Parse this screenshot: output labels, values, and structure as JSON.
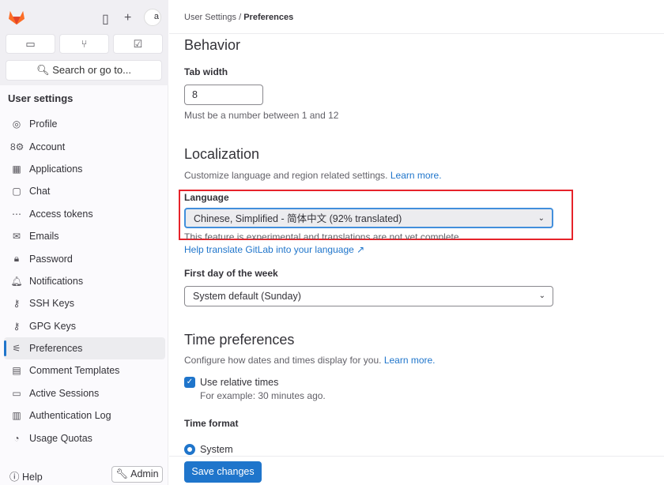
{
  "topbar": {
    "avatar_text": "a",
    "search_label": "Search or go to..."
  },
  "sidebar": {
    "title": "User settings",
    "items": [
      {
        "label": "Profile",
        "icon": "profile-icon",
        "glyph": "◎"
      },
      {
        "label": "Account",
        "icon": "account-icon",
        "glyph": "8⚙"
      },
      {
        "label": "Applications",
        "icon": "applications-icon",
        "glyph": "▦"
      },
      {
        "label": "Chat",
        "icon": "chat-icon",
        "glyph": "▢"
      },
      {
        "label": "Access tokens",
        "icon": "token-icon",
        "glyph": "⋯"
      },
      {
        "label": "Emails",
        "icon": "email-icon",
        "glyph": "✉"
      },
      {
        "label": "Password",
        "icon": "lock-icon",
        "glyph": "🔒︎"
      },
      {
        "label": "Notifications",
        "icon": "bell-icon",
        "glyph": "🔔︎"
      },
      {
        "label": "SSH Keys",
        "icon": "key-icon",
        "glyph": "⚷"
      },
      {
        "label": "GPG Keys",
        "icon": "key-icon",
        "glyph": "⚷"
      },
      {
        "label": "Preferences",
        "icon": "preferences-icon",
        "glyph": "⚟",
        "active": true
      },
      {
        "label": "Comment Templates",
        "icon": "comment-icon",
        "glyph": "▤"
      },
      {
        "label": "Active Sessions",
        "icon": "monitor-icon",
        "glyph": "▭"
      },
      {
        "label": "Authentication Log",
        "icon": "log-icon",
        "glyph": "▥"
      },
      {
        "label": "Usage Quotas",
        "icon": "quota-icon",
        "glyph": "◔"
      }
    ],
    "help": "Help",
    "admin": "Admin"
  },
  "breadcrumb": {
    "parent": "User Settings",
    "sep": "/",
    "current": "Preferences"
  },
  "behavior": {
    "title": "Behavior",
    "tab_width_label": "Tab width",
    "tab_width_value": "8",
    "tab_width_help": "Must be a number between 1 and 12"
  },
  "localization": {
    "title": "Localization",
    "desc": "Customize language and region related settings.",
    "learn_more": "Learn more.",
    "language_label": "Language",
    "language_value": "Chinese, Simplified - 简体中文 (92% translated)",
    "language_help": "This feature is experimental and translations are not yet complete.",
    "help_translate": "Help translate GitLab into your language",
    "first_day_label": "First day of the week",
    "first_day_value": "System default (Sunday)"
  },
  "time": {
    "title": "Time preferences",
    "desc": "Configure how dates and times display for you.",
    "learn_more": "Learn more.",
    "relative_label": "Use relative times",
    "relative_checked": true,
    "relative_help": "For example: 30 minutes ago.",
    "format_label": "Time format",
    "format_value": "System"
  },
  "save_label": "Save changes",
  "colors": {
    "accent": "#1f75cb",
    "highlight": "#e6232a"
  }
}
